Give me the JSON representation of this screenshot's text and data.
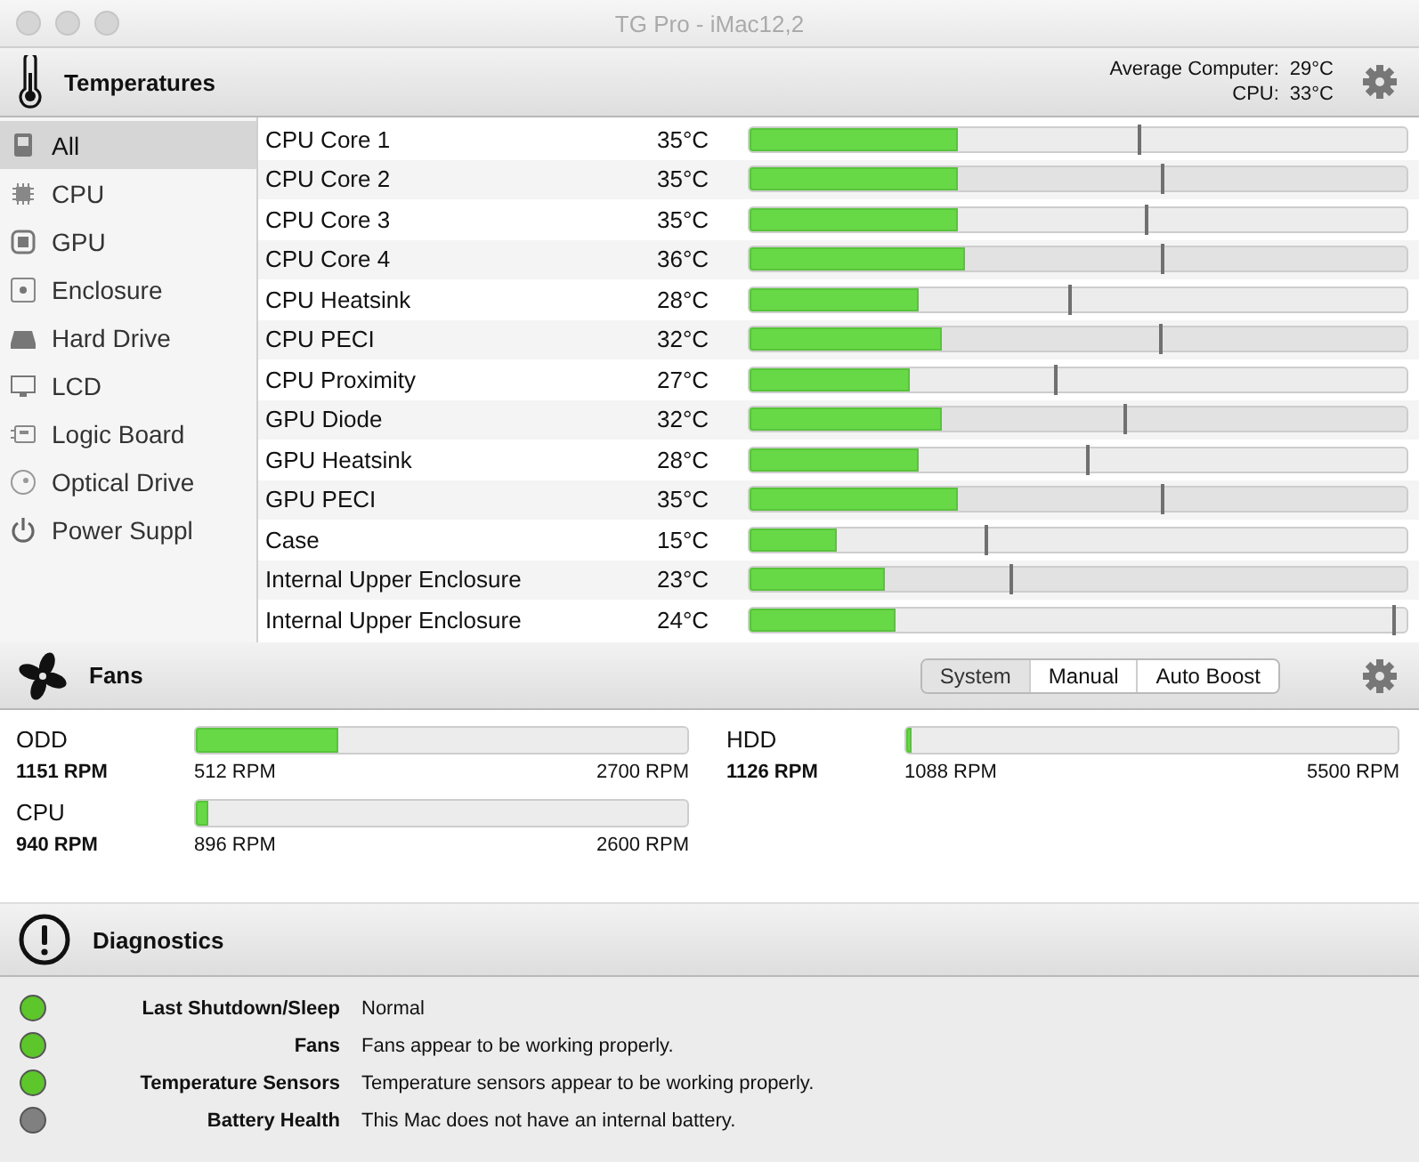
{
  "window": {
    "title": "TG Pro - iMac12,2"
  },
  "temperatures": {
    "title": "Temperatures",
    "summary": [
      {
        "label": "Average Computer:",
        "value": "29°C"
      },
      {
        "label": "CPU:",
        "value": "33°C"
      }
    ],
    "sidebar": {
      "items": [
        {
          "label": "All",
          "kind": "computer",
          "selected": true
        },
        {
          "label": "CPU",
          "kind": "chip",
          "selected": false
        },
        {
          "label": "GPU",
          "kind": "gpu",
          "selected": false
        },
        {
          "label": "Enclosure",
          "kind": "enclosure",
          "selected": false
        },
        {
          "label": "Hard Drive",
          "kind": "drive",
          "selected": false
        },
        {
          "label": "LCD",
          "kind": "display",
          "selected": false
        },
        {
          "label": "Logic Board",
          "kind": "board",
          "selected": false
        },
        {
          "label": "Optical Drive",
          "kind": "disc",
          "selected": false
        },
        {
          "label": "Power Suppl",
          "kind": "power",
          "selected": false
        }
      ]
    },
    "sensors": [
      {
        "name": "CPU Core 1",
        "value": "35°C",
        "level": 0.317,
        "max_marker": {
          "level": 0.593
        }
      },
      {
        "name": "CPU Core 2",
        "value": "35°C",
        "level": 0.317,
        "max_marker": {
          "level": 0.63
        }
      },
      {
        "name": "CPU Core 3",
        "value": "35°C",
        "level": 0.317,
        "max_marker": {
          "level": 0.603
        }
      },
      {
        "name": "CPU Core 4",
        "value": "36°C",
        "level": 0.328,
        "max_marker": {
          "level": 0.63
        }
      },
      {
        "name": "CPU Heatsink",
        "value": "28°C",
        "level": 0.257,
        "max_marker": {
          "level": 0.487
        }
      },
      {
        "name": "CPU PECI",
        "value": "32°C",
        "level": 0.292,
        "max_marker": {
          "level": 0.627
        }
      },
      {
        "name": "CPU Proximity",
        "value": "27°C",
        "level": 0.244,
        "max_marker": {
          "level": 0.465
        }
      },
      {
        "name": "GPU Diode",
        "value": "32°C",
        "level": 0.292,
        "max_marker": {
          "level": 0.573
        }
      },
      {
        "name": "GPU Heatsink",
        "value": "28°C",
        "level": 0.257,
        "max_marker": {
          "level": 0.516
        }
      },
      {
        "name": "GPU PECI",
        "value": "35°C",
        "level": 0.317,
        "max_marker": {
          "level": 0.63
        }
      },
      {
        "name": "Case",
        "value": "15°C",
        "level": 0.134,
        "max_marker": {
          "level": 0.36
        }
      },
      {
        "name": "Internal Upper Enclosure",
        "value": "23°C",
        "level": 0.206,
        "max_marker": {
          "level": 0.398
        }
      },
      {
        "name": "Internal Upper Enclosure",
        "value": "24°C",
        "level": 0.221,
        "max_marker": {
          "level": 0.98
        }
      }
    ]
  },
  "fans": {
    "title": "Fans",
    "modes": [
      {
        "label": "System",
        "selected": true
      },
      {
        "label": "Manual",
        "selected": false
      },
      {
        "label": "Auto Boost",
        "selected": false
      }
    ],
    "items": [
      {
        "name": "ODD",
        "current": "1151 RPM",
        "min": "512 RPM",
        "max": "2700 RPM",
        "level": 0.29
      },
      {
        "name": "HDD",
        "current": "1126 RPM",
        "min": "1088 RPM",
        "max": "5500 RPM",
        "level": 0.01
      },
      {
        "name": "CPU",
        "current": "940 RPM",
        "min": "896 RPM",
        "max": "2600 RPM",
        "level": 0.025
      }
    ]
  },
  "diagnostics": {
    "title": "Diagnostics",
    "items": [
      {
        "label": "Last Shutdown/Sleep",
        "message": "Normal",
        "color": "#5cc62a"
      },
      {
        "label": "Fans",
        "message": "Fans appear to be working properly.",
        "color": "#5cc62a"
      },
      {
        "label": "Temperature Sensors",
        "message": "Temperature sensors appear to be working properly.",
        "color": "#5cc62a"
      },
      {
        "label": "Battery Health",
        "message": "This Mac does not have an internal battery.",
        "color": "#808080"
      }
    ]
  }
}
